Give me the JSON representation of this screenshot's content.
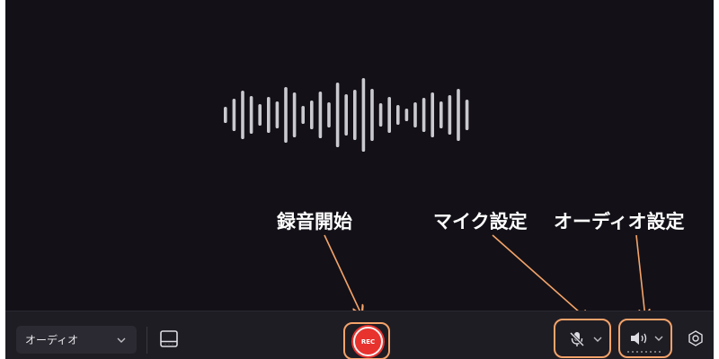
{
  "annotations": {
    "rec_start": "録音開始",
    "mic_settings": "マイク設定",
    "audio_settings": "オーディオ設定"
  },
  "toolbar": {
    "source_select": {
      "value": "オーディオ"
    },
    "rec_button_label": "REC"
  },
  "icons": {
    "layout": "layout-icon",
    "mic_muted": "mic-muted-icon",
    "speaker": "speaker-icon",
    "settings": "settings-hex-icon",
    "chevron": "chevron-down-icon"
  },
  "colors": {
    "background": "#131117",
    "toolbar": "#1f1d24",
    "rec_red": "#e8322e",
    "highlight_orange": "#f4a36a",
    "annotation_text": "#ffffff"
  }
}
